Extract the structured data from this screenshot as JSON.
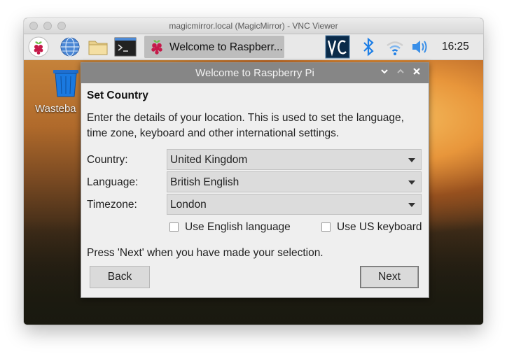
{
  "viewer": {
    "title": "magicmirror.local (MagicMirror) - VNC Viewer"
  },
  "taskbar": {
    "active_task_label": "Welcome to Raspberr...",
    "clock": "16:25",
    "icons": [
      "raspberry-menu-icon",
      "web-browser-icon",
      "file-manager-icon",
      "terminal-icon",
      "vnc-server-icon",
      "bluetooth-icon",
      "wifi-icon",
      "volume-icon"
    ]
  },
  "desktop": {
    "trash_label": "Wasteba"
  },
  "dialog": {
    "title": "Welcome to Raspberry Pi",
    "heading": "Set Country",
    "description": "Enter the details of your location. This is used to set the language, time zone, keyboard and other international settings.",
    "fields": [
      {
        "label": "Country:",
        "value": "United Kingdom"
      },
      {
        "label": "Language:",
        "value": "British English"
      },
      {
        "label": "Timezone:",
        "value": "London"
      }
    ],
    "checkboxes": [
      {
        "label": "Use English language",
        "checked": false
      },
      {
        "label": "Use US keyboard",
        "checked": false
      }
    ],
    "hint": "Press 'Next' when you have made your selection.",
    "back_label": "Back",
    "next_label": "Next"
  },
  "colors": {
    "titlebar": "#868686",
    "dialog_bg": "#efefef",
    "taskbar": "#e8e8e8",
    "raspberry_red": "#c51a4a",
    "bluetooth_blue": "#1e7fe6"
  }
}
